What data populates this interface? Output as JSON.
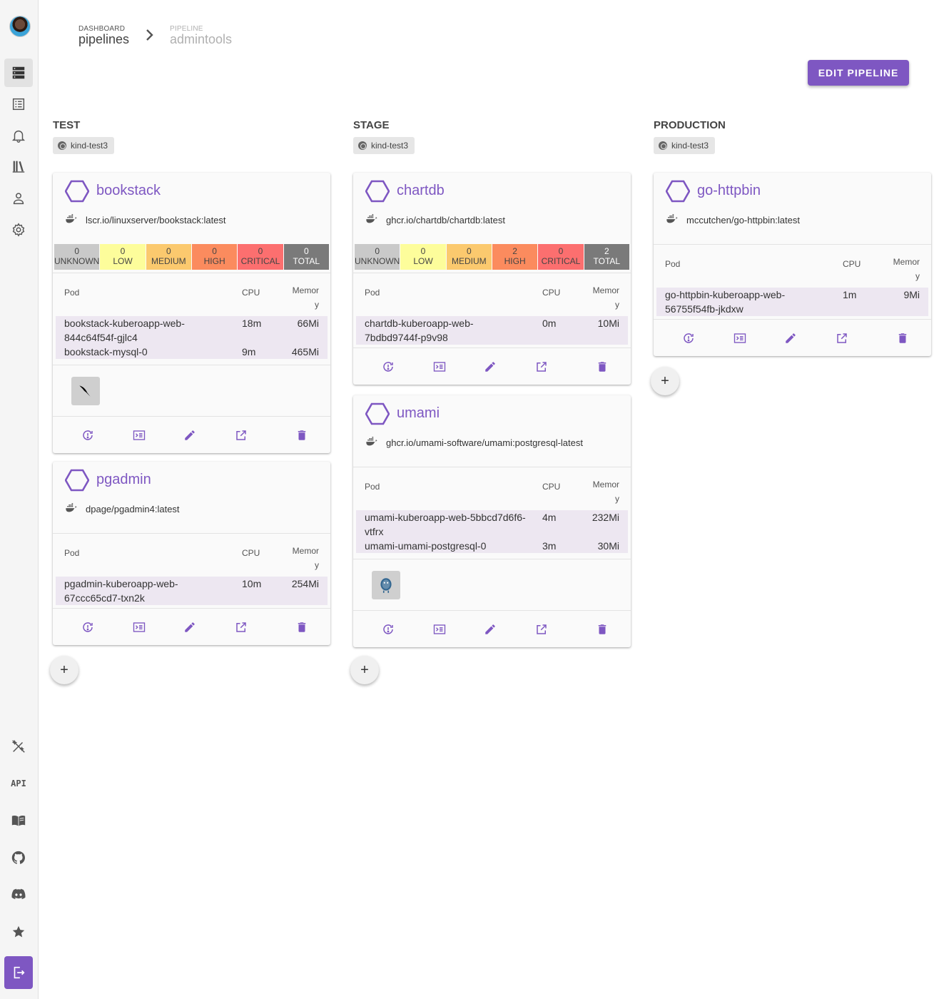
{
  "breadcrumb": {
    "dashboard_small": "DASHBOARD",
    "dashboard_big": "pipelines",
    "pipeline_small": "PIPELINE",
    "pipeline_big": "admintools"
  },
  "edit_pipeline_label": "EDIT PIPELINE",
  "accent_color": "#7e57c2",
  "sidebar": {
    "top_items": [
      "server-icon",
      "list-icon",
      "bell-icon",
      "library-icon",
      "person-icon",
      "gear-icon"
    ],
    "bottom_items": [
      "magic-wand-icon",
      "api-icon",
      "book-icon",
      "github-icon",
      "discord-icon",
      "star-icon",
      "logout-icon"
    ],
    "api_label": "API"
  },
  "vuln_labels": [
    "UNKNOWN",
    "LOW",
    "MEDIUM",
    "HIGH",
    "CRITICAL",
    "TOTAL"
  ],
  "pod_columns": {
    "pod": "Pod",
    "cpu": "CPU",
    "memory": "Memory"
  },
  "phases": [
    {
      "title": "TEST",
      "cluster": "kind-test3",
      "apps": [
        {
          "name": "bookstack",
          "image": "lscr.io/linuxserver/bookstack:latest",
          "vulns": [
            "0",
            "0",
            "0",
            "0",
            "0",
            "0"
          ],
          "pods": [
            {
              "name": "bookstack-kuberoapp-web-844c64f54f-gjlc4",
              "cpu": "18m",
              "mem": "66Mi"
            },
            {
              "name": "bookstack-mysql-0",
              "cpu": "9m",
              "mem": "465Mi"
            }
          ],
          "addon": "mysql-icon"
        },
        {
          "name": "pgadmin",
          "image": "dpage/pgadmin4:latest",
          "pods": [
            {
              "name": "pgadmin-kuberoapp-web-67ccc65cd7-txn2k",
              "cpu": "10m",
              "mem": "254Mi"
            }
          ]
        }
      ]
    },
    {
      "title": "STAGE",
      "cluster": "kind-test3",
      "apps": [
        {
          "name": "chartdb",
          "image": "ghcr.io/chartdb/chartdb:latest",
          "vulns": [
            "0",
            "0",
            "0",
            "2",
            "0",
            "2"
          ],
          "pods": [
            {
              "name": "chartdb-kuberoapp-web-7bdbd9744f-p9v98",
              "cpu": "0m",
              "mem": "10Mi"
            }
          ]
        },
        {
          "name": "umami",
          "image": "ghcr.io/umami-software/umami:postgresql-latest",
          "pods": [
            {
              "name": "umami-kuberoapp-web-5bbcd7d6f6-vtfrx",
              "cpu": "4m",
              "mem": "232Mi"
            },
            {
              "name": "umami-umami-postgresql-0",
              "cpu": "3m",
              "mem": "30Mi"
            }
          ],
          "addon": "postgresql-icon"
        }
      ]
    },
    {
      "title": "PRODUCTION",
      "cluster": "kind-test3",
      "apps": [
        {
          "name": "go-httpbin",
          "image": "mccutchen/go-httpbin:latest",
          "pods": [
            {
              "name": "go-httpbin-kuberoapp-web-56755f54fb-jkdxw",
              "cpu": "1m",
              "mem": "9Mi"
            }
          ]
        }
      ]
    }
  ],
  "add_button_label": "+"
}
